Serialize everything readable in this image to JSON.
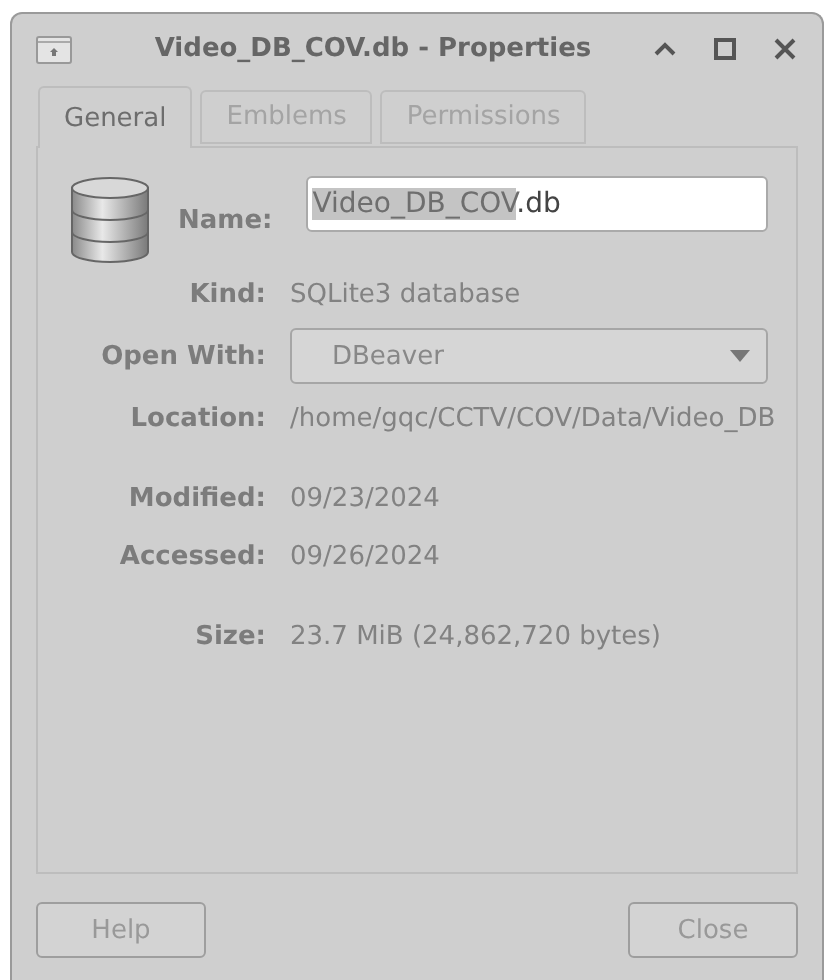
{
  "window": {
    "title": "Video_DB_COV.db - Properties"
  },
  "tabs": [
    {
      "label": "General",
      "selected": true
    },
    {
      "label": "Emblems",
      "selected": false
    },
    {
      "label": "Permissions",
      "selected": false
    }
  ],
  "name": {
    "label": "Name:",
    "selected_text": "Video_DB_COV",
    "rest_text": ".db"
  },
  "fields": [
    {
      "kind": "text",
      "label": "Kind:",
      "value": "SQLite3 database"
    },
    {
      "kind": "combo",
      "label": "Open With:",
      "value": "DBeaver"
    },
    {
      "kind": "text",
      "label": "Location:",
      "value": "/home/gqc/CCTV/COV/Data/Video_DB"
    },
    {
      "kind": "gap"
    },
    {
      "kind": "text",
      "label": "Modified:",
      "value": "09/23/2024"
    },
    {
      "kind": "text",
      "label": "Accessed:",
      "value": "09/26/2024"
    },
    {
      "kind": "gap"
    },
    {
      "kind": "text",
      "label": "Size:",
      "value": "23.7 MiB (24,862,720 bytes)"
    }
  ],
  "buttons": [
    "Help",
    "Close"
  ]
}
